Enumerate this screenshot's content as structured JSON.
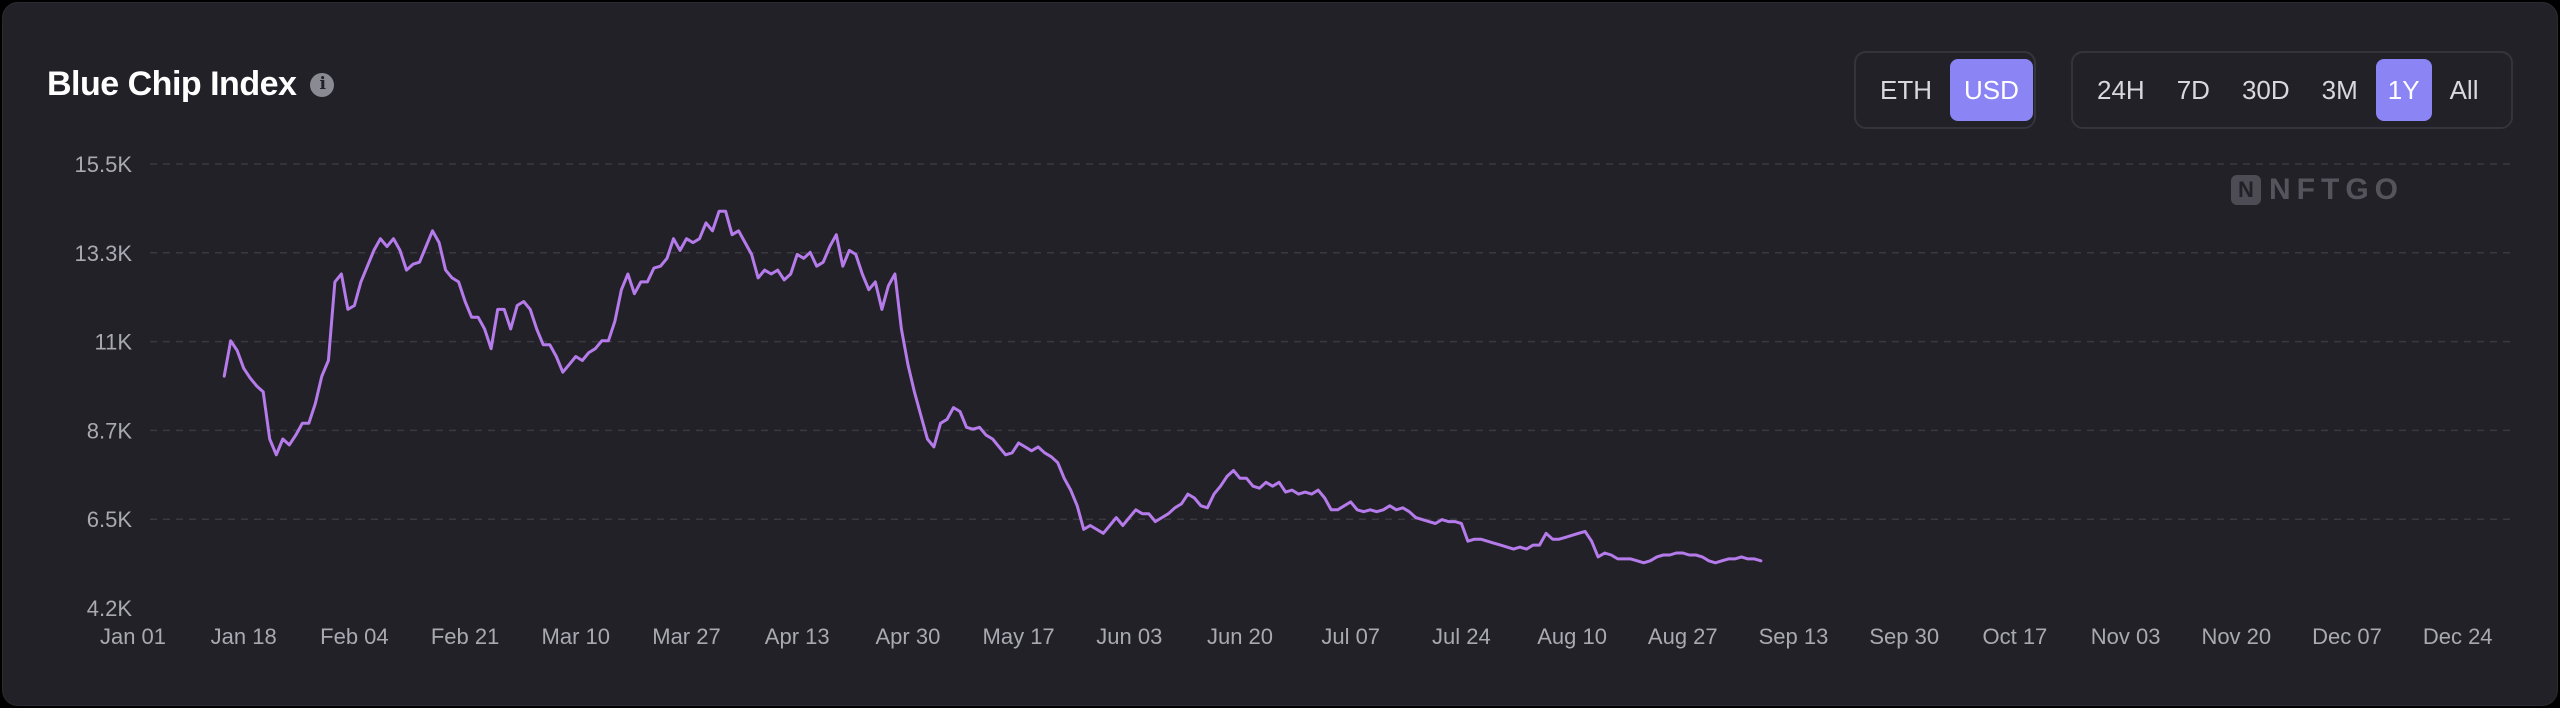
{
  "header": {
    "title": "Blue Chip Index",
    "info_icon": "info-icon"
  },
  "currency_toggle": {
    "options": [
      "ETH",
      "USD"
    ],
    "selected": "USD"
  },
  "range_toggle": {
    "options": [
      "24H",
      "7D",
      "30D",
      "3M",
      "1Y",
      "All"
    ],
    "selected": "1Y"
  },
  "watermark": {
    "logo_letter": "N",
    "text": "NFTGO"
  },
  "colors": {
    "background": "#222127",
    "line": "#b57bea",
    "active_button": "#8a84f5",
    "grid": "#3a3940"
  },
  "chart_data": {
    "type": "line",
    "title": "Blue Chip Index",
    "xlabel": "",
    "ylabel": "",
    "grid": true,
    "y_ticks": [
      "4.2K",
      "6.5K",
      "8.7K",
      "11K",
      "13.3K",
      "15.5K"
    ],
    "y_tick_values": [
      4200,
      6460,
      8720,
      10980,
      13240,
      15500
    ],
    "ylim": [
      4200,
      15500
    ],
    "x_ticks": [
      "Jan 01",
      "Jan 18",
      "Feb 04",
      "Feb 21",
      "Mar 10",
      "Mar 27",
      "Apr 13",
      "Apr 30",
      "May 17",
      "Jun 03",
      "Jun 20",
      "Jul 07",
      "Jul 24",
      "Aug 10",
      "Aug 27",
      "Sep 13",
      "Sep 30",
      "Oct 17",
      "Nov 03",
      "Nov 20",
      "Dec 07",
      "Dec 24"
    ],
    "x_tick_days": [
      0,
      17,
      34,
      51,
      68,
      85,
      102,
      119,
      136,
      153,
      170,
      187,
      204,
      221,
      238,
      255,
      272,
      289,
      306,
      323,
      340,
      357
    ],
    "xlim_days": [
      0,
      362
    ],
    "series": [
      {
        "points": [
          [
            14,
            10100
          ],
          [
            15,
            11000
          ],
          [
            16,
            10750
          ],
          [
            17,
            10300
          ],
          [
            18,
            10050
          ],
          [
            19,
            9850
          ],
          [
            20,
            9700
          ],
          [
            21,
            8500
          ],
          [
            22,
            8100
          ],
          [
            23,
            8500
          ],
          [
            24,
            8350
          ],
          [
            25,
            8600
          ],
          [
            26,
            8900
          ],
          [
            27,
            8900
          ],
          [
            28,
            9400
          ],
          [
            29,
            10100
          ],
          [
            30,
            10500
          ],
          [
            31,
            12500
          ],
          [
            32,
            12700
          ],
          [
            33,
            11800
          ],
          [
            34,
            11900
          ],
          [
            35,
            12500
          ],
          [
            36,
            12900
          ],
          [
            37,
            13300
          ],
          [
            38,
            13600
          ],
          [
            39,
            13400
          ],
          [
            40,
            13600
          ],
          [
            41,
            13300
          ],
          [
            42,
            12800
          ],
          [
            43,
            12950
          ],
          [
            44,
            13000
          ],
          [
            45,
            13400
          ],
          [
            46,
            13800
          ],
          [
            47,
            13500
          ],
          [
            48,
            12800
          ],
          [
            49,
            12600
          ],
          [
            50,
            12500
          ],
          [
            51,
            12000
          ],
          [
            52,
            11600
          ],
          [
            53,
            11600
          ],
          [
            54,
            11300
          ],
          [
            55,
            10800
          ],
          [
            56,
            11800
          ],
          [
            57,
            11800
          ],
          [
            58,
            11300
          ],
          [
            59,
            11900
          ],
          [
            60,
            12000
          ],
          [
            61,
            11800
          ],
          [
            62,
            11300
          ],
          [
            63,
            10900
          ],
          [
            64,
            10900
          ],
          [
            65,
            10600
          ],
          [
            66,
            10200
          ],
          [
            67,
            10400
          ],
          [
            68,
            10600
          ],
          [
            69,
            10500
          ],
          [
            70,
            10700
          ],
          [
            71,
            10800
          ],
          [
            72,
            11000
          ],
          [
            73,
            11000
          ],
          [
            74,
            11500
          ],
          [
            75,
            12300
          ],
          [
            76,
            12700
          ],
          [
            77,
            12200
          ],
          [
            78,
            12500
          ],
          [
            79,
            12500
          ],
          [
            80,
            12850
          ],
          [
            81,
            12900
          ],
          [
            82,
            13100
          ],
          [
            83,
            13600
          ],
          [
            84,
            13300
          ],
          [
            85,
            13600
          ],
          [
            86,
            13500
          ],
          [
            87,
            13600
          ],
          [
            88,
            14000
          ],
          [
            89,
            13800
          ],
          [
            90,
            14300
          ],
          [
            91,
            14300
          ],
          [
            92,
            13700
          ],
          [
            93,
            13800
          ],
          [
            94,
            13500
          ],
          [
            95,
            13200
          ],
          [
            96,
            12600
          ],
          [
            97,
            12800
          ],
          [
            98,
            12700
          ],
          [
            99,
            12800
          ],
          [
            100,
            12550
          ],
          [
            101,
            12700
          ],
          [
            102,
            13200
          ],
          [
            103,
            13100
          ],
          [
            104,
            13250
          ],
          [
            105,
            12900
          ],
          [
            106,
            13000
          ],
          [
            107,
            13400
          ],
          [
            108,
            13700
          ],
          [
            109,
            12900
          ],
          [
            110,
            13300
          ],
          [
            111,
            13200
          ],
          [
            112,
            12700
          ],
          [
            113,
            12300
          ],
          [
            114,
            12500
          ],
          [
            115,
            11800
          ],
          [
            116,
            12400
          ],
          [
            117,
            12700
          ],
          [
            118,
            11300
          ],
          [
            119,
            10400
          ],
          [
            120,
            9700
          ],
          [
            121,
            9100
          ],
          [
            122,
            8500
          ],
          [
            123,
            8300
          ],
          [
            124,
            8900
          ],
          [
            125,
            9000
          ],
          [
            126,
            9300
          ],
          [
            127,
            9200
          ],
          [
            128,
            8800
          ],
          [
            129,
            8750
          ],
          [
            130,
            8800
          ],
          [
            131,
            8600
          ],
          [
            132,
            8500
          ],
          [
            133,
            8300
          ],
          [
            134,
            8100
          ],
          [
            135,
            8150
          ],
          [
            136,
            8400
          ],
          [
            137,
            8300
          ],
          [
            138,
            8200
          ],
          [
            139,
            8300
          ],
          [
            140,
            8150
          ],
          [
            141,
            8050
          ],
          [
            142,
            7900
          ],
          [
            143,
            7500
          ],
          [
            144,
            7200
          ],
          [
            145,
            6800
          ],
          [
            146,
            6200
          ],
          [
            147,
            6300
          ],
          [
            148,
            6200
          ],
          [
            149,
            6100
          ],
          [
            150,
            6300
          ],
          [
            151,
            6500
          ],
          [
            152,
            6300
          ],
          [
            153,
            6500
          ],
          [
            154,
            6700
          ],
          [
            155,
            6600
          ],
          [
            156,
            6600
          ],
          [
            157,
            6400
          ],
          [
            158,
            6500
          ],
          [
            159,
            6600
          ],
          [
            160,
            6750
          ],
          [
            161,
            6850
          ],
          [
            162,
            7100
          ],
          [
            163,
            7000
          ],
          [
            164,
            6800
          ],
          [
            165,
            6750
          ],
          [
            166,
            7100
          ],
          [
            167,
            7300
          ],
          [
            168,
            7550
          ],
          [
            169,
            7700
          ],
          [
            170,
            7500
          ],
          [
            171,
            7500
          ],
          [
            172,
            7300
          ],
          [
            173,
            7250
          ],
          [
            174,
            7400
          ],
          [
            175,
            7300
          ],
          [
            176,
            7400
          ],
          [
            177,
            7150
          ],
          [
            178,
            7200
          ],
          [
            179,
            7100
          ],
          [
            180,
            7150
          ],
          [
            181,
            7100
          ],
          [
            182,
            7200
          ],
          [
            183,
            7000
          ],
          [
            184,
            6700
          ],
          [
            185,
            6700
          ],
          [
            186,
            6800
          ],
          [
            187,
            6900
          ],
          [
            188,
            6700
          ],
          [
            189,
            6650
          ],
          [
            190,
            6700
          ],
          [
            191,
            6650
          ],
          [
            192,
            6700
          ],
          [
            193,
            6800
          ],
          [
            194,
            6700
          ],
          [
            195,
            6750
          ],
          [
            196,
            6650
          ],
          [
            197,
            6500
          ],
          [
            198,
            6450
          ],
          [
            199,
            6400
          ],
          [
            200,
            6350
          ],
          [
            201,
            6450
          ],
          [
            202,
            6400
          ],
          [
            203,
            6400
          ],
          [
            204,
            6350
          ],
          [
            205,
            5900
          ],
          [
            206,
            5950
          ],
          [
            207,
            5950
          ],
          [
            208,
            5900
          ],
          [
            209,
            5850
          ],
          [
            210,
            5800
          ],
          [
            211,
            5750
          ],
          [
            212,
            5700
          ],
          [
            213,
            5750
          ],
          [
            214,
            5700
          ],
          [
            215,
            5800
          ],
          [
            216,
            5800
          ],
          [
            217,
            6100
          ],
          [
            218,
            5950
          ],
          [
            219,
            5950
          ],
          [
            220,
            6000
          ],
          [
            221,
            6050
          ],
          [
            222,
            6100
          ],
          [
            223,
            6150
          ],
          [
            224,
            5900
          ],
          [
            225,
            5500
          ],
          [
            226,
            5600
          ],
          [
            227,
            5550
          ],
          [
            228,
            5450
          ],
          [
            229,
            5450
          ],
          [
            230,
            5450
          ],
          [
            231,
            5400
          ],
          [
            232,
            5350
          ],
          [
            233,
            5400
          ],
          [
            234,
            5500
          ],
          [
            235,
            5550
          ],
          [
            236,
            5550
          ],
          [
            237,
            5600
          ],
          [
            238,
            5600
          ],
          [
            239,
            5550
          ],
          [
            240,
            5550
          ],
          [
            241,
            5500
          ],
          [
            242,
            5400
          ],
          [
            243,
            5350
          ],
          [
            244,
            5400
          ],
          [
            245,
            5450
          ],
          [
            246,
            5450
          ],
          [
            247,
            5500
          ],
          [
            248,
            5450
          ],
          [
            249,
            5450
          ],
          [
            250,
            5400
          ]
        ],
        "x_scale_note_days": "x in days since Jan 01"
      }
    ]
  }
}
